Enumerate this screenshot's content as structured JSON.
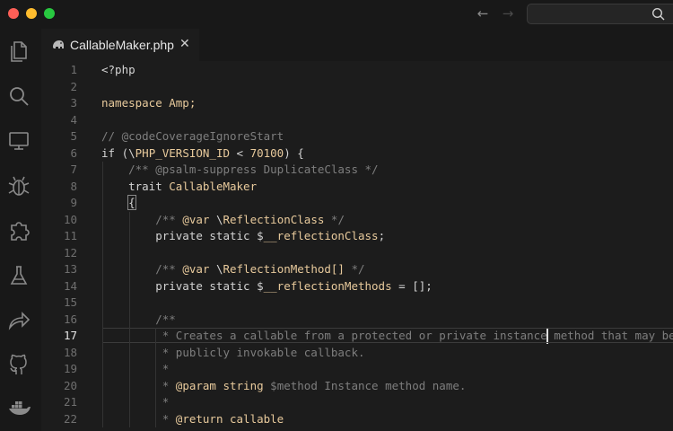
{
  "window": {
    "search_placeholder": ""
  },
  "tab": {
    "filename": "CallableMaker.php",
    "close_glyph": "✕"
  },
  "nav": {
    "back_glyph": "←",
    "forward_glyph": "→"
  },
  "activity_bar": [
    {
      "name": "files-icon"
    },
    {
      "name": "search-icon"
    },
    {
      "name": "monitor-icon"
    },
    {
      "name": "bug-icon"
    },
    {
      "name": "puzzle-icon"
    },
    {
      "name": "flask-icon"
    },
    {
      "name": "share-arrow-icon"
    },
    {
      "name": "github-icon"
    },
    {
      "name": "docker-icon"
    }
  ],
  "editor": {
    "active_line": 17,
    "lines": [
      {
        "n": "1",
        "tokens": [
          [
            "tx",
            "<?php"
          ]
        ]
      },
      {
        "n": "2",
        "tokens": []
      },
      {
        "n": "3",
        "tokens": [
          [
            "kw",
            "namespace Amp;"
          ]
        ]
      },
      {
        "n": "4",
        "tokens": []
      },
      {
        "n": "5",
        "tokens": [
          [
            "cm",
            "// @codeCoverageIgnoreStart"
          ]
        ]
      },
      {
        "n": "6",
        "tokens": [
          [
            "tx",
            "if (\\"
          ],
          [
            "kw",
            "PHP_VERSION_ID"
          ],
          [
            "tx",
            " < "
          ],
          [
            "num",
            "70100"
          ],
          [
            "tx",
            ") {"
          ]
        ]
      },
      {
        "n": "7",
        "tokens": [
          [
            "tx",
            "    "
          ],
          [
            "cm",
            "/** @psalm-suppress DuplicateClass */"
          ]
        ]
      },
      {
        "n": "8",
        "tokens": [
          [
            "tx",
            "    trait "
          ],
          [
            "kw",
            "CallableMaker"
          ]
        ]
      },
      {
        "n": "9",
        "tokens": [
          [
            "tx",
            "    "
          ],
          [
            "br",
            "{"
          ]
        ]
      },
      {
        "n": "10",
        "tokens": [
          [
            "tx",
            "        "
          ],
          [
            "cm",
            "/** "
          ],
          [
            "tg",
            "@var"
          ],
          [
            "tx",
            " \\"
          ],
          [
            "kw",
            "ReflectionClass"
          ],
          [
            "cm",
            " */"
          ]
        ]
      },
      {
        "n": "11",
        "tokens": [
          [
            "tx",
            "        private static $"
          ],
          [
            "kw",
            "__reflectionClass"
          ],
          [
            "tx",
            ";"
          ]
        ]
      },
      {
        "n": "12",
        "tokens": []
      },
      {
        "n": "13",
        "tokens": [
          [
            "tx",
            "        "
          ],
          [
            "cm",
            "/** "
          ],
          [
            "tg",
            "@var"
          ],
          [
            "tx",
            " \\"
          ],
          [
            "kw",
            "ReflectionMethod[]"
          ],
          [
            "cm",
            " */"
          ]
        ]
      },
      {
        "n": "14",
        "tokens": [
          [
            "tx",
            "        private static $"
          ],
          [
            "kw",
            "__reflectionMethods"
          ],
          [
            "tx",
            " = [];"
          ]
        ]
      },
      {
        "n": "15",
        "tokens": []
      },
      {
        "n": "16",
        "tokens": [
          [
            "tx",
            "        "
          ],
          [
            "cm",
            "/**"
          ]
        ]
      },
      {
        "n": "17",
        "tokens": [
          [
            "tx",
            "        "
          ],
          [
            "cm",
            " * Creates a callable from a protected or private instance method that may be"
          ]
        ]
      },
      {
        "n": "18",
        "tokens": [
          [
            "tx",
            "        "
          ],
          [
            "cm",
            " * publicly invokable callback."
          ]
        ]
      },
      {
        "n": "19",
        "tokens": [
          [
            "tx",
            "        "
          ],
          [
            "cm",
            " *"
          ]
        ]
      },
      {
        "n": "20",
        "tokens": [
          [
            "tx",
            "        "
          ],
          [
            "cm",
            " * "
          ],
          [
            "tg",
            "@param string"
          ],
          [
            "cm",
            " $method Instance method name."
          ]
        ]
      },
      {
        "n": "21",
        "tokens": [
          [
            "tx",
            "        "
          ],
          [
            "cm",
            " *"
          ]
        ]
      },
      {
        "n": "22",
        "tokens": [
          [
            "tx",
            "        "
          ],
          [
            "cm",
            " * "
          ],
          [
            "tg",
            "@return callable"
          ]
        ]
      }
    ]
  }
}
